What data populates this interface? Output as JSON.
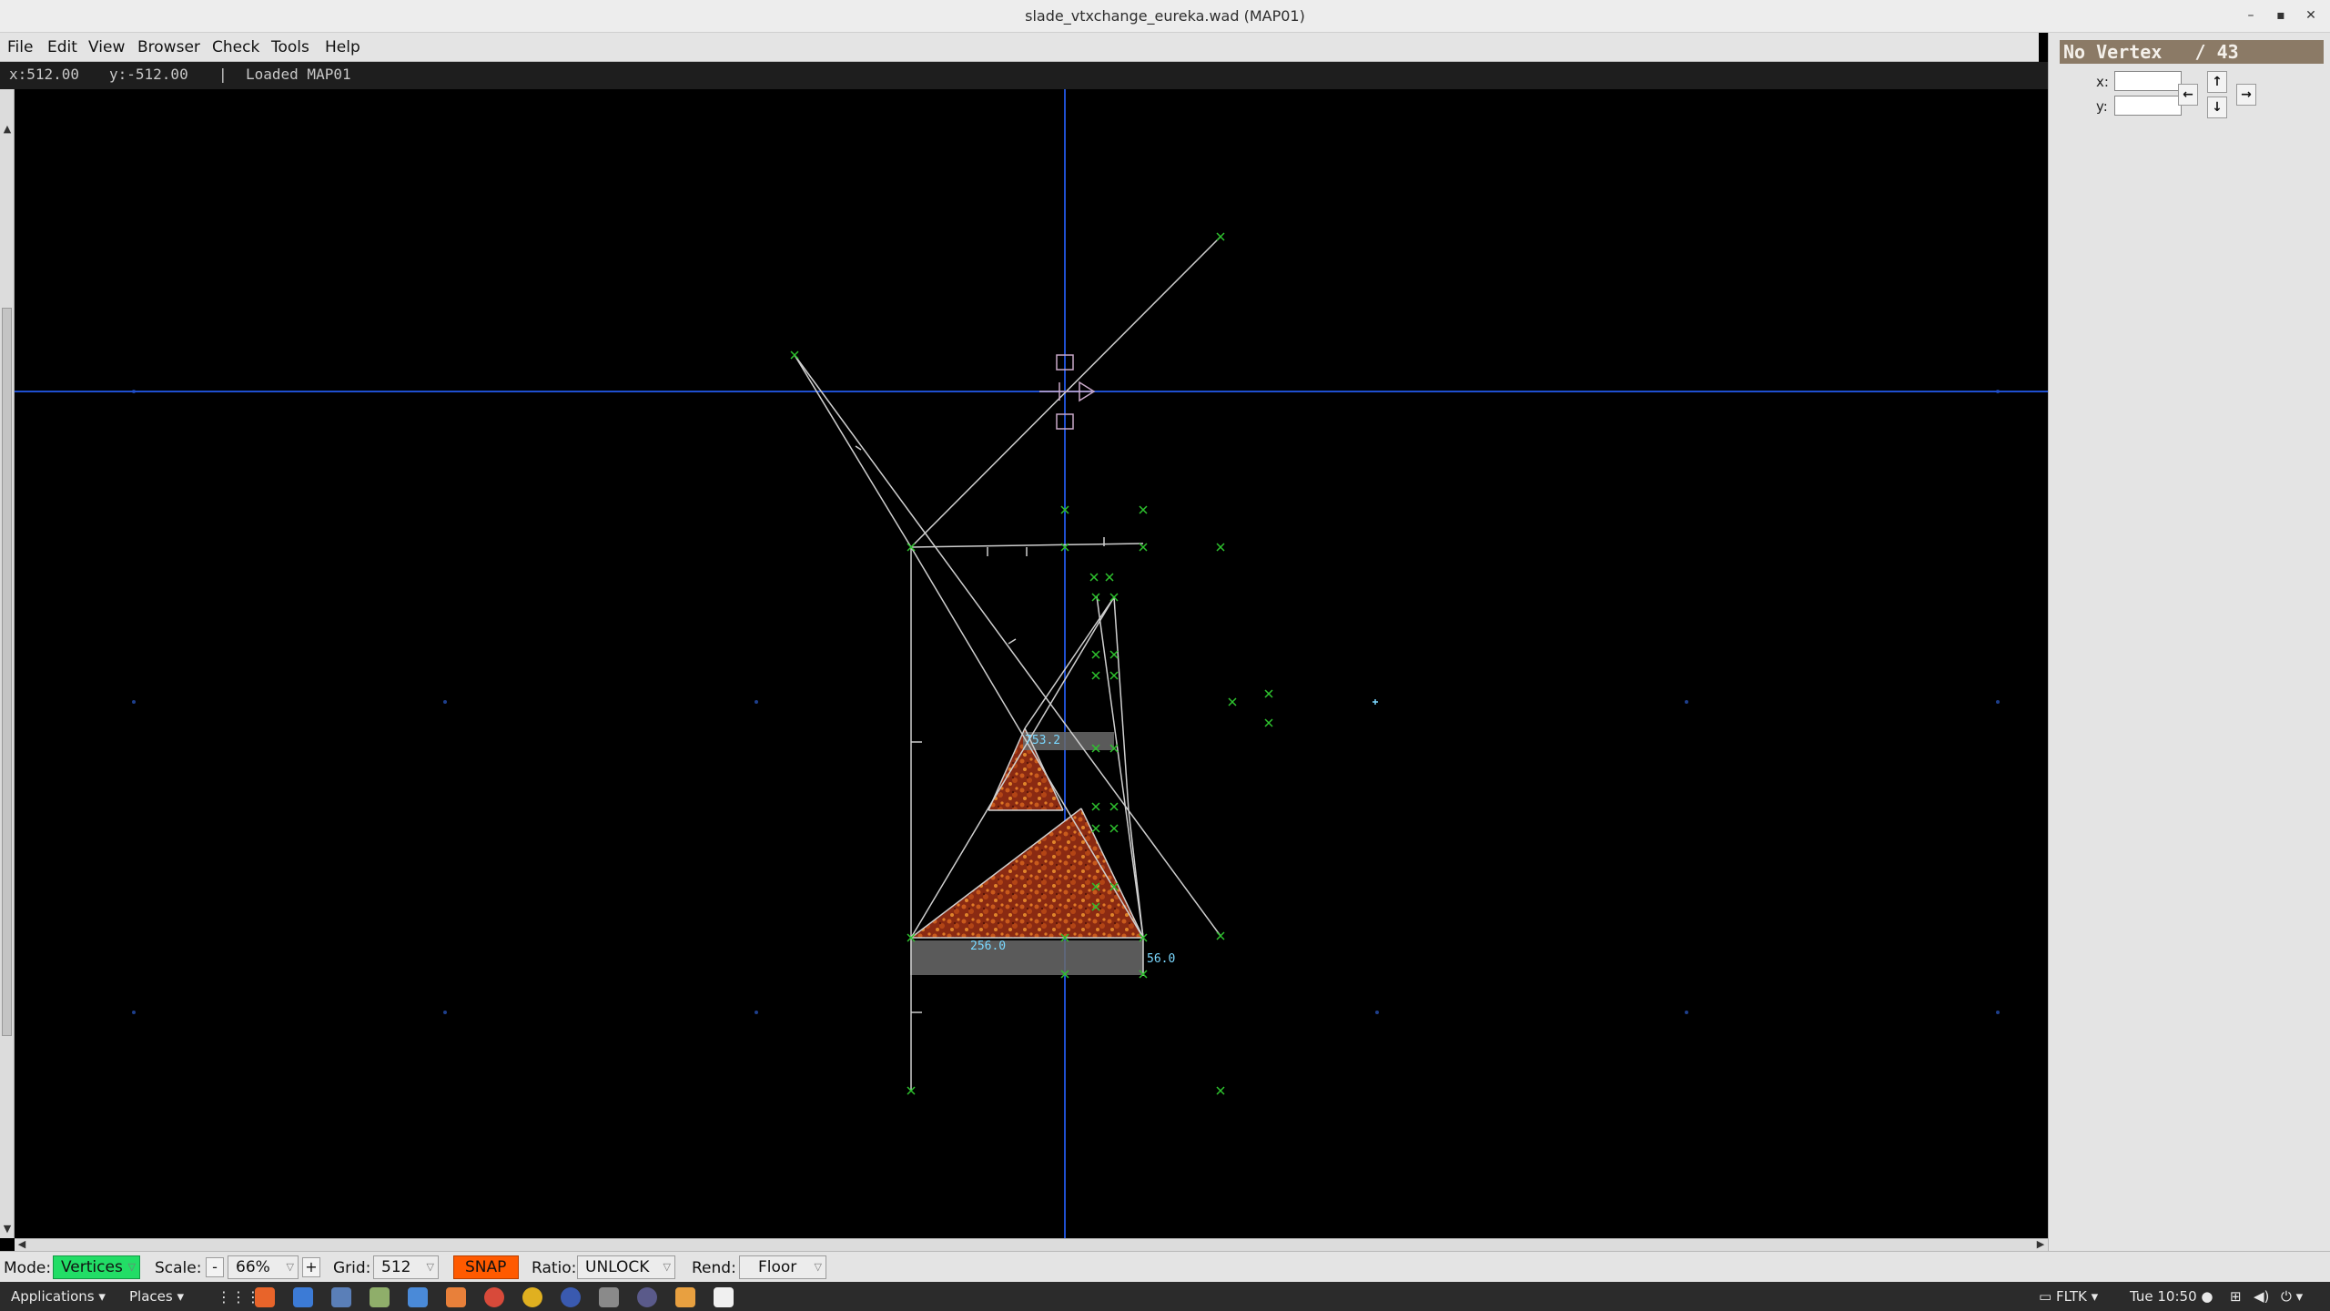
{
  "window": {
    "title": "slade_vtxchange_eureka.wad (MAP01)"
  },
  "menubar": {
    "items": [
      "File",
      "Edit",
      "View",
      "Browser",
      "Check",
      "Tools",
      "Help"
    ]
  },
  "coords": {
    "x": "x:512.00",
    "y": "y:-512.00",
    "sep": "|",
    "message": "Loaded MAP01"
  },
  "map": {
    "labels": {
      "upper_height": "753.2",
      "lower_width": "256.0",
      "lower_height": "56.0"
    }
  },
  "panel": {
    "title": "No Vertex",
    "count": "/ 43",
    "x_label": "x:",
    "y_label": "y:",
    "x_value": "",
    "y_value": ""
  },
  "status": {
    "mode_label": "Mode:",
    "mode_value": "Vertices",
    "scale_label": "Scale:",
    "scale_minus": "-",
    "scale_value": "66%",
    "scale_plus": "+",
    "grid_label": "Grid:",
    "grid_value": "512",
    "snap": "SNAP",
    "ratio_label": "Ratio:",
    "ratio_value": "UNLOCK",
    "rend_label": "Rend:",
    "rend_value": "Floor"
  },
  "taskbar": {
    "applications": "Applications",
    "places": "Places",
    "fltk": "FLTK",
    "clock": "Tue 10:50",
    "launchers": [
      "firefox-icon",
      "files-icon",
      "calendar-icon",
      "text-editor-icon",
      "document-icon",
      "software-icon",
      "help-icon",
      "chrome-icon",
      "app-icon",
      "terminal-icon",
      "settings-icon",
      "notes-icon",
      "window-icon"
    ]
  },
  "colors": {
    "mode_green": "#22dd66",
    "snap_orange": "#ff5a00",
    "panel_header": "#8b7a66",
    "grid_blue": "#1f4fd0",
    "line_white": "#cfcfcf",
    "vertex_green": "#2ec22e",
    "label_cyan": "#7ad8ff"
  }
}
